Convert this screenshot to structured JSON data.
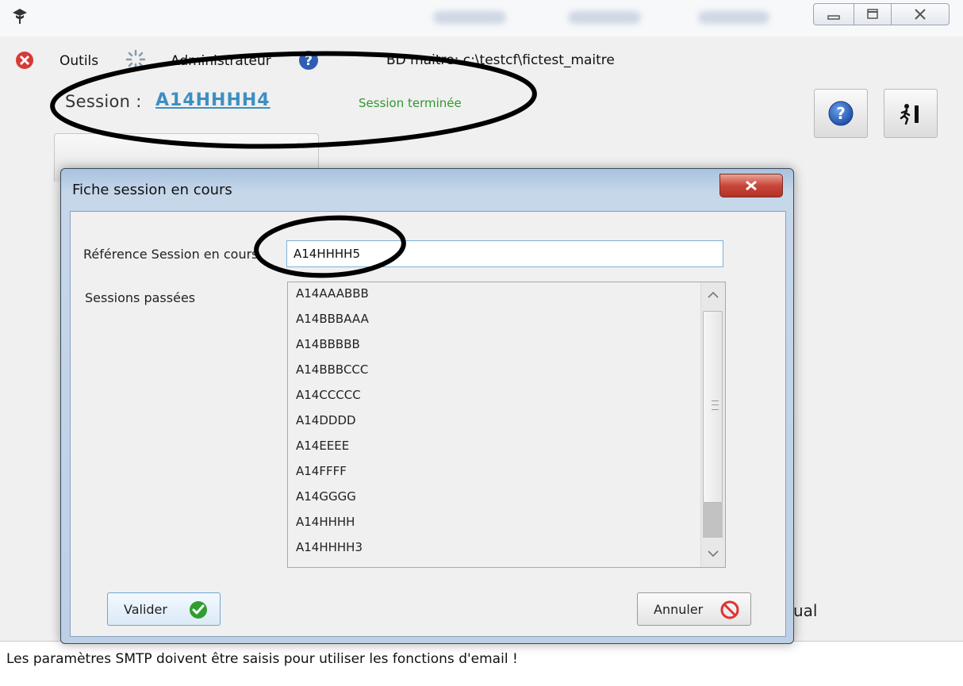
{
  "window": {
    "controls": [
      "minimize-icon",
      "maximize-icon",
      "close-icon"
    ]
  },
  "menubar": {
    "items": [
      {
        "icon": "close-circle-icon"
      },
      {
        "label": "Outils"
      },
      {
        "icon": "settings-spinner-icon"
      },
      {
        "label": "Administrateur"
      },
      {
        "icon": "help-circle-icon"
      }
    ],
    "db_path": "BD maitre: c:\\testcf\\fictest_maitre"
  },
  "header": {
    "session_label": "Session :",
    "session_code": "A14HHHH4",
    "session_status": "Session terminée",
    "buttons": [
      "help-icon",
      "exit-icon"
    ]
  },
  "background": {
    "partial_text": "ual"
  },
  "status_bar": {
    "message": "Les paramètres SMTP doivent être saisis pour utiliser les fonctions d'email  !"
  },
  "dialog": {
    "title": "Fiche session en cours",
    "ref_label": "Référence Session en cours",
    "ref_value": "A14HHHH5",
    "past_label": "Sessions passées",
    "past_sessions": [
      "A14AAABBB",
      "A14BBBAAA",
      "A14BBBBB",
      "A14BBBCCC",
      "A14CCCCC",
      "A14DDDD",
      "A14EEEE",
      "A14FFFF",
      "A14GGGG",
      "A14HHHH",
      "A14HHHH3"
    ],
    "valider_label": "Valider",
    "annuler_label": "Annuler"
  },
  "colors": {
    "session_code": "#3d8fc2",
    "session_status": "#2e9a2e",
    "dialog_close": "#c9463a"
  }
}
